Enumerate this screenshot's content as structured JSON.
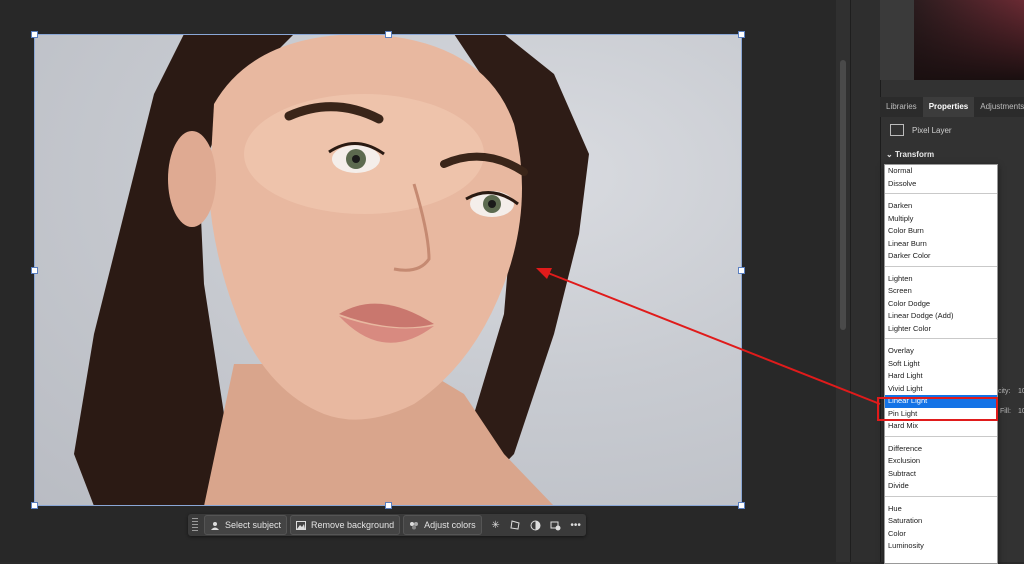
{
  "taskbar": {
    "select_subject": "Select subject",
    "remove_background": "Remove background",
    "adjust_colors": "Adjust colors",
    "icons": [
      "sparkle-icon",
      "transform-icon",
      "mask-icon",
      "replace-icon",
      "more-icon"
    ],
    "more_glyph": "•••"
  },
  "panel": {
    "tabs": [
      {
        "label": "Libraries",
        "active": false
      },
      {
        "label": "Properties",
        "active": true
      },
      {
        "label": "Adjustments",
        "active": false
      }
    ],
    "layer_type": "Pixel Layer",
    "section_title": "Transform",
    "fragments": {
      "opacity": "city:",
      "opacity_value": "10",
      "fill": "Fill:",
      "fill_value": "10"
    }
  },
  "blend_menu": {
    "groups": [
      [
        "Normal",
        "Dissolve"
      ],
      [
        "Darken",
        "Multiply",
        "Color Burn",
        "Linear Burn",
        "Darker Color"
      ],
      [
        "Lighten",
        "Screen",
        "Color Dodge",
        "Linear Dodge (Add)",
        "Lighter Color"
      ],
      [
        "Overlay",
        "Soft Light",
        "Hard Light",
        "Vivid Light",
        "Linear Light",
        "Pin Light",
        "Hard Mix"
      ],
      [
        "Difference",
        "Exclusion",
        "Subtract",
        "Divide"
      ],
      [
        "Hue",
        "Saturation",
        "Color",
        "Luminosity"
      ]
    ],
    "selected": "Linear Light"
  },
  "colors": {
    "accent_selection": "#1473e6",
    "annotation_red": "#e01b1b"
  }
}
